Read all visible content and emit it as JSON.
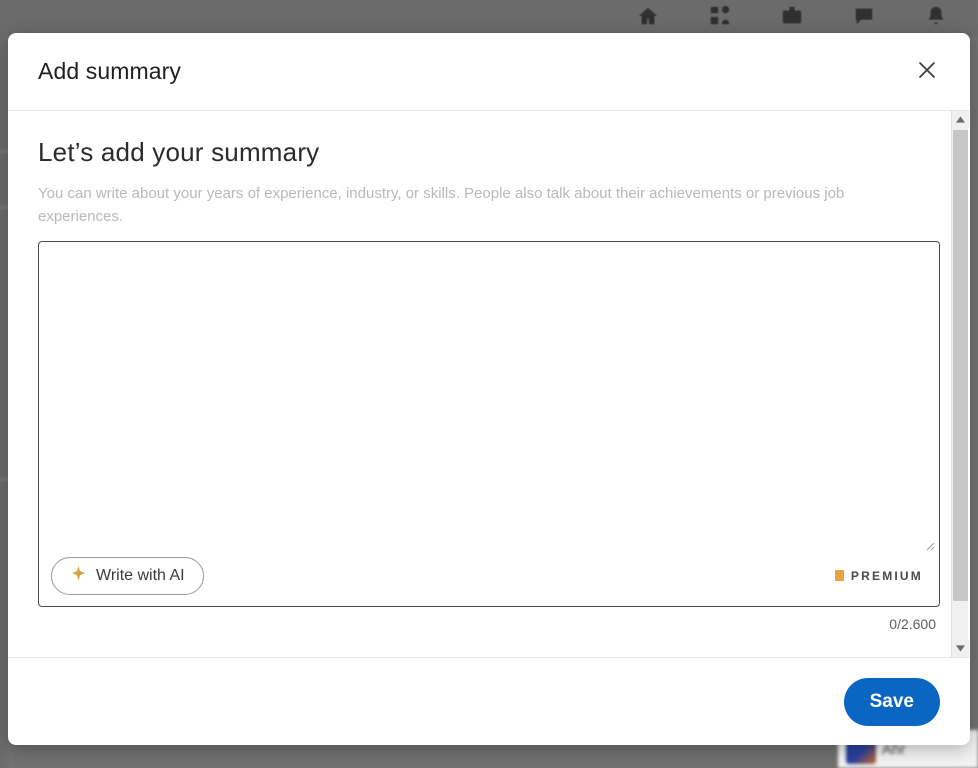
{
  "background": {
    "nav_icons": [
      {
        "name": "home-icon",
        "label": "Home"
      },
      {
        "name": "network-icon",
        "label": "My Network"
      },
      {
        "name": "jobs-icon",
        "label": "Jobs"
      },
      {
        "name": "messaging-icon",
        "label": "Messaging"
      },
      {
        "name": "notifications-icon",
        "label": "Notifications"
      }
    ],
    "chat_bar": {
      "name": "Ahr"
    }
  },
  "modal": {
    "title": "Add summary",
    "close_label": "Dismiss",
    "heading": "Let’s add your summary",
    "description": "You can write about your years of experience, industry, or skills. People also talk about their achievements or previous job experiences.",
    "textarea": {
      "value": "",
      "placeholder": ""
    },
    "ai_button": {
      "label": "Write with AI",
      "icon": "sparkle-icon"
    },
    "premium_badge": {
      "label": "PREMIUM",
      "color": "#e7a33e"
    },
    "char_counter": "0/2.600",
    "scrollbar": {
      "up_arrow": "▲",
      "down_arrow": "▼"
    },
    "footer": {
      "save_label": "Save",
      "save_color": "#0a66c2"
    }
  }
}
